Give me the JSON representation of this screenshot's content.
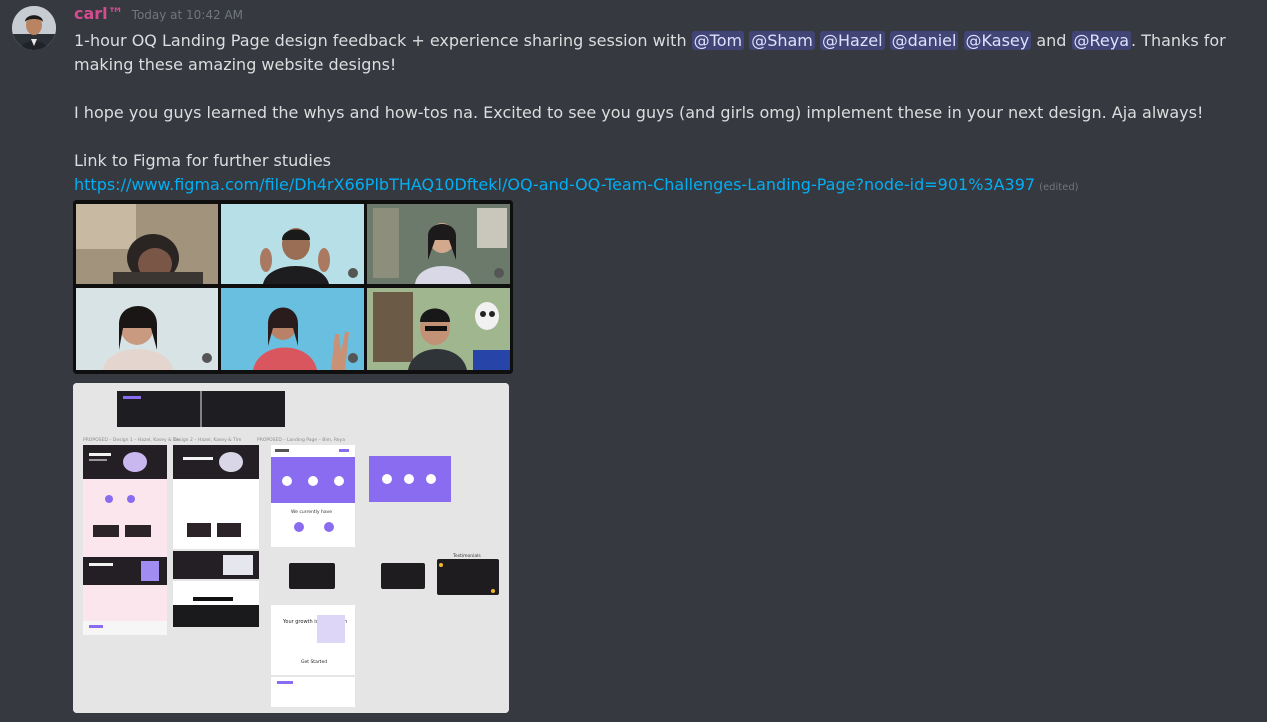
{
  "message": {
    "username": "carl™",
    "timestamp": "Today at 10:42 AM",
    "line1_pre": "1-hour OQ Landing Page design feedback + experience sharing session with ",
    "mentions": [
      "@Tom",
      "@Sham",
      "@Hazel",
      "@daniel",
      "@Kasey",
      "@Reya"
    ],
    "conj": "and",
    "line1_post": ". Thanks for making these amazing website designs!",
    "para2": "I hope you guys learned the whys and how-tos na. Excited to see you guys (and girls omg) implement these in your next design. Aja always!",
    "para3_label": "Link to Figma for further studies",
    "link": "https://www.figma.com/file/Dh4rX66PlbTHAQ10Dftekl/OQ-and-OQ-Team-Challenges-Landing-Page?node-id=901%3A397",
    "edited": "(edited)"
  },
  "attachments": {
    "video_call_tiles": 6,
    "design_board": {
      "left_title": "PROPOSED – Design 1 – Hazel, Kasey & Tin",
      "middle_title": "Design 2 – Hazel, Kasey & Tim",
      "right_title": "PROPOSED – Landing Page – Bim, Reya",
      "section_label": "We currently have",
      "growth_label": "Your growth is our growth",
      "get_started": "Get Started",
      "testimonials": "Testimonials"
    }
  },
  "colors": {
    "background": "#36393f",
    "username": "#d24c8f",
    "mention_bg": "#414675",
    "link": "#00aff4",
    "accent_purple": "#8a6cf0"
  }
}
